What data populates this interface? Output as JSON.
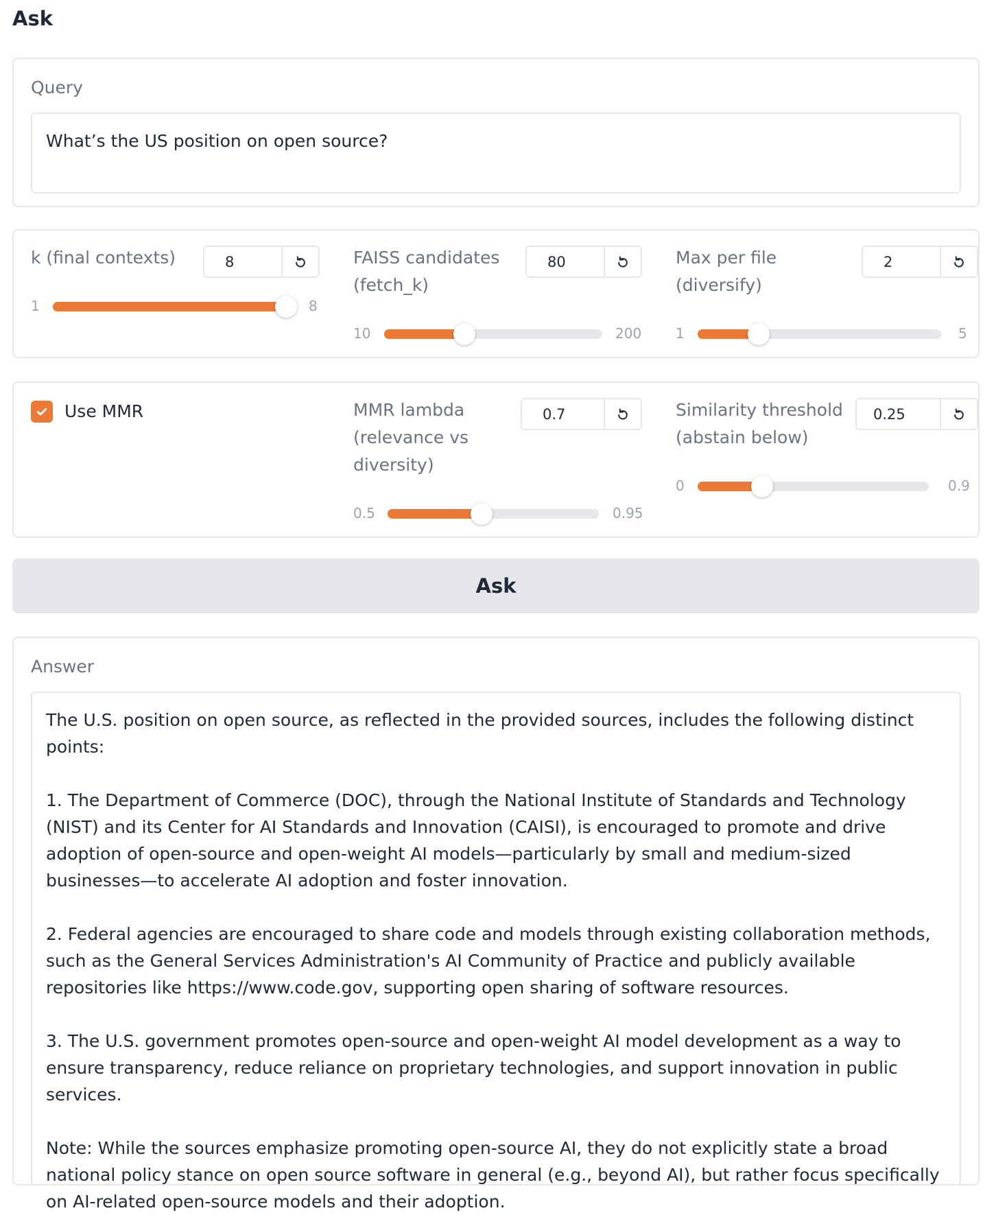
{
  "page_title": "Ask",
  "query": {
    "label": "Query",
    "value": "What’s the US position on open source?"
  },
  "controls": {
    "k": {
      "label_line1": "k (final contexts)",
      "value": "8",
      "min": "1",
      "max": "8",
      "fraction": 1.0
    },
    "faiss": {
      "label_line1": "FAISS candidates",
      "label_line2": "(fetch_k)",
      "value": "80",
      "min": "10",
      "max": "200",
      "fraction": 0.368
    },
    "max_per_file": {
      "label_line1": "Max per file",
      "label_line2": "(diversify)",
      "value": "2",
      "min": "1",
      "max": "5",
      "fraction": 0.25
    },
    "use_mmr": {
      "label": "Use MMR",
      "checked": true
    },
    "mmr_lambda": {
      "label_line1": "MMR lambda",
      "label_line2": "(relevance vs",
      "label_line3": "diversity)",
      "value": "0.7",
      "min": "0.5",
      "max": "0.95",
      "fraction": 0.444
    },
    "similarity": {
      "label_line1": "Similarity threshold",
      "label_line2": "(abstain below)",
      "value": "0.25",
      "min": "0",
      "max": "0.9",
      "fraction": 0.278
    }
  },
  "ask_button": "Ask",
  "answer": {
    "label": "Answer",
    "paragraphs": [
      "The U.S. position on open source, as reflected in the provided sources, includes the following distinct points:",
      "1. The Department of Commerce (DOC), through the National Institute of Standards and Technology (NIST) and its Center for AI Standards and Innovation (CAISI), is encouraged to promote and drive adoption of open-source and open-weight AI models—particularly by small and medium-sized businesses—to accelerate AI adoption and foster innovation.",
      "2. Federal agencies are encouraged to share code and models through existing collaboration methods, such as the General Services Administration's AI Community of Practice and publicly available repositories like https://www.code.gov, supporting open sharing of software resources.",
      "3. The U.S. government promotes open-source and open-weight AI model development as a way to ensure transparency, reduce reliance on proprietary technologies, and support innovation in public services.",
      "Note: While the sources emphasize promoting open-source AI, they do not explicitly state a broad national policy stance on open source software in general (e.g., beyond AI), but rather focus specifically on AI-related open-source models and their adoption."
    ]
  },
  "colors": {
    "accent": "#ea7a35",
    "border": "#e5e7eb",
    "button_bg": "#e5e7eb"
  }
}
